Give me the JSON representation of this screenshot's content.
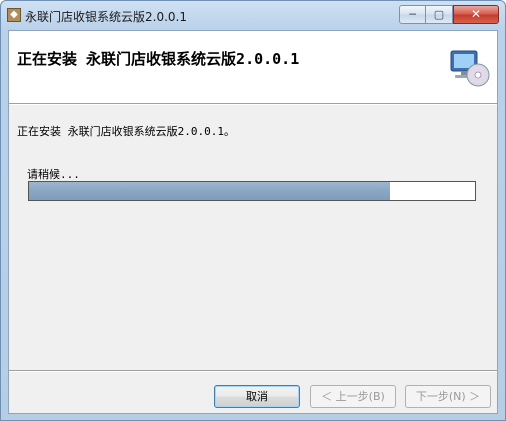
{
  "window": {
    "title": "永联门店收银系统云版2.0.0.1",
    "minimize_glyph": "─",
    "maximize_glyph": "▢",
    "close_glyph": "✕"
  },
  "banner": {
    "title": "正在安装 永联门店收银系统云版2.0.0.1",
    "icon": "computer-cd-icon"
  },
  "status": {
    "message": "正在安装 永联门店收银系统云版2.0.0.1。",
    "wait_label": "请稍候..."
  },
  "progress": {
    "fraction": 0.81
  },
  "buttons": {
    "cancel": "取消",
    "previous": "＜ 上一步(B)",
    "next": "下一步(N) ＞"
  },
  "colors": {
    "progress_fill": "#8aa6c3",
    "close_button": "#c23b2c"
  }
}
